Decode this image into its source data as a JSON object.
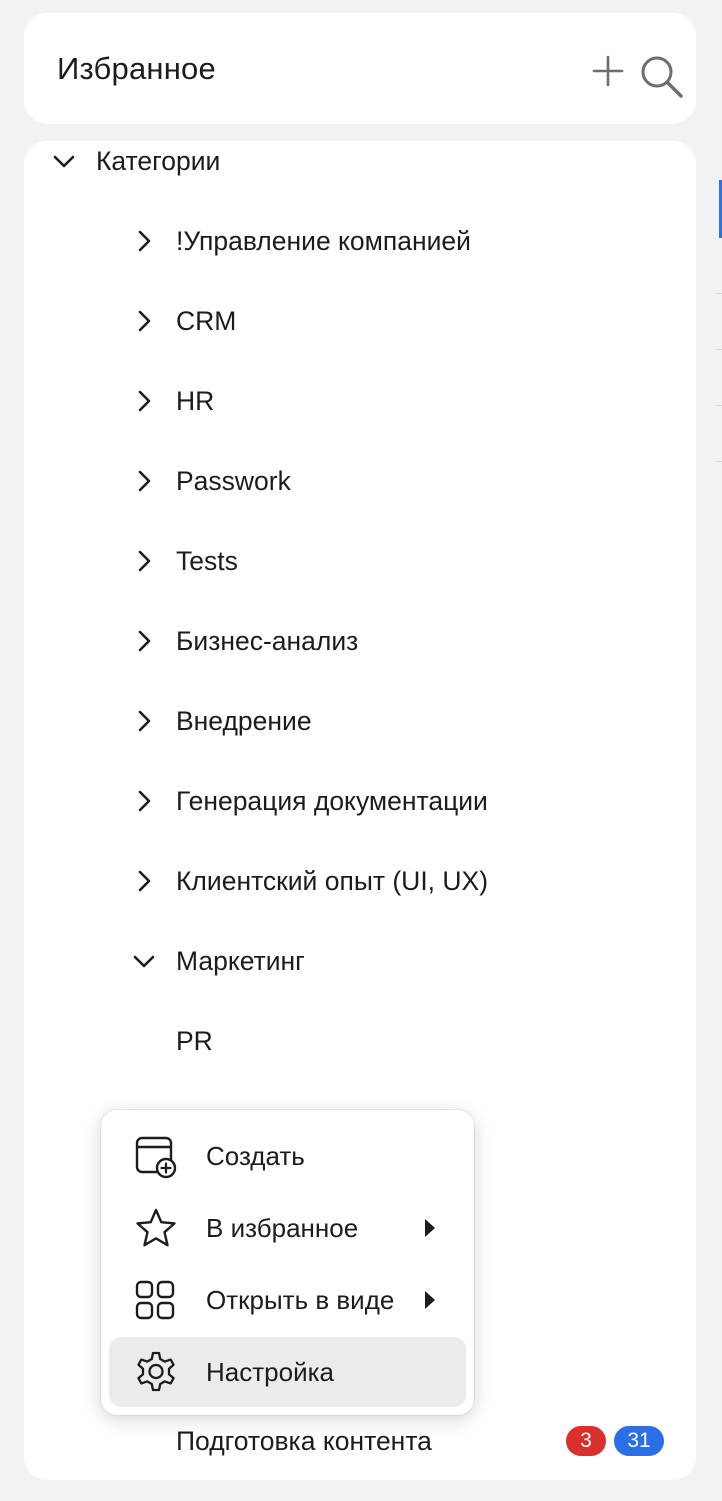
{
  "header": {
    "title": "Избранное",
    "icons": [
      "plus-icon",
      "search-icon"
    ]
  },
  "tree": {
    "root": {
      "label": "Категории",
      "expanded": true
    },
    "items": [
      {
        "label": "!Управление компанией",
        "expanded": false
      },
      {
        "label": "CRM",
        "expanded": false
      },
      {
        "label": "HR",
        "expanded": false
      },
      {
        "label": "Passwork",
        "expanded": false
      },
      {
        "label": "Tests",
        "expanded": false
      },
      {
        "label": "Бизнес-анализ",
        "expanded": false
      },
      {
        "label": "Внедрение",
        "expanded": false
      },
      {
        "label": "Генерация документации",
        "expanded": false
      },
      {
        "label": "Клиентский опыт (UI, UX)",
        "expanded": false
      },
      {
        "label": "Маркетинг",
        "expanded": true
      }
    ],
    "marketing_children": [
      {
        "label": "PR"
      },
      {
        "label": "Подготовка контента",
        "badges": [
          {
            "value": "3",
            "color": "#d9302c"
          },
          {
            "value": "31",
            "color": "#2a6ee8"
          }
        ]
      }
    ]
  },
  "context_menu": {
    "items": [
      {
        "label": "Создать",
        "icon": "calendar-add-icon",
        "submenu": false,
        "active": false
      },
      {
        "label": "В избранное",
        "icon": "star-icon",
        "submenu": true,
        "active": false
      },
      {
        "label": "Открыть в виде",
        "icon": "grid-view-icon",
        "submenu": true,
        "active": false
      },
      {
        "label": "Настройка",
        "icon": "gear-icon",
        "submenu": false,
        "active": true
      }
    ]
  },
  "colors": {
    "background": "#f2f2f4",
    "card": "#ffffff",
    "accent": "#2f6fde",
    "badge_red": "#d9302c",
    "badge_blue": "#2a6ee8",
    "menu_active": "#ebebed"
  }
}
